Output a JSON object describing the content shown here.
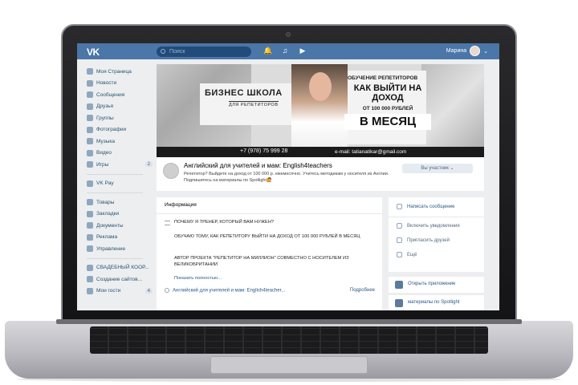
{
  "topbar": {
    "logo": "VK",
    "search_placeholder": "Поиск",
    "user_name": "Марина",
    "icons": [
      "bell-icon",
      "music-icon",
      "video-icon"
    ]
  },
  "nav": {
    "items": [
      {
        "label": "Моя Страница",
        "icon": "home-icon"
      },
      {
        "label": "Новости",
        "icon": "news-icon"
      },
      {
        "label": "Сообщения",
        "icon": "message-icon"
      },
      {
        "label": "Друзья",
        "icon": "friends-icon"
      },
      {
        "label": "Группы",
        "icon": "groups-icon"
      },
      {
        "label": "Фотографии",
        "icon": "photo-icon"
      },
      {
        "label": "Музыка",
        "icon": "music-icon"
      },
      {
        "label": "Видео",
        "icon": "video-icon"
      },
      {
        "label": "Игры",
        "icon": "games-icon",
        "badge": "2"
      }
    ],
    "pay": {
      "label": "VK Pay",
      "icon": "pay-icon"
    },
    "items2": [
      {
        "label": "Товары",
        "icon": "goods-icon"
      },
      {
        "label": "Закладки",
        "icon": "bookmark-icon"
      },
      {
        "label": "Документы",
        "icon": "document-icon"
      },
      {
        "label": "Реклама",
        "icon": "ads-icon"
      },
      {
        "label": "Управление",
        "icon": "manage-icon"
      }
    ],
    "items3": [
      {
        "label": "СВАДЕБНЫЙ КООР...",
        "icon": "group-icon"
      },
      {
        "label": "Создание сайтов...",
        "icon": "group-icon"
      },
      {
        "label": "Мои гости",
        "icon": "guests-icon",
        "badge": "4"
      }
    ]
  },
  "cover": {
    "left_title": "БИЗНЕС ШКОЛА",
    "left_sub": "ДЛЯ РЕПЕТИТОРОВ",
    "right_1": "ОБУЧЕНИЕ РЕПЕТИТОРОВ",
    "right_2": "КАК ВЫЙТИ НА ДОХОД",
    "right_3": "ОТ 100 000 РУБЛЕЙ",
    "right_4": "В МЕСЯЦ",
    "phone": "+7 (978) 75 999 28",
    "email": "e-mail: tatianatikar@gmail.com"
  },
  "group": {
    "name": "Английский для учителей и мам: English4teachers",
    "description": "Репетитор? Выйдите на доход от 100 000 р. ежемесячно. Учитесь методикам у носителя из Англии. Подпишитесь на материалы по Spotlight🙋",
    "member_button": "Вы участник ⌄"
  },
  "info": {
    "title": "Информация",
    "line1": "ПОЧЕМУ Я ТРЕНЕР, КОТОРЫЙ ВАМ НУЖЕН?",
    "line2": "ОБУЧАЮ ТОМУ, КАК РЕПЕТИТОРУ ВЫЙТИ НА ДОХОД ОТ 100 000 РУБЛЕЙ В МЕСЯЦ",
    "line3": "АВТОР ПРОЕКТА \"РЕПЕТИТОР НА МИЛЛИОН\" СОВМЕСТНО С НОСИТЕЛЕМ ИЗ ВЕЛИКОБРИТАНИИ",
    "more": "Показать полностью...",
    "link": "Английский для учителей и мам: English4teacher...",
    "details": "Подробнее"
  },
  "actions": {
    "write": "Написать сообщение",
    "notify": "Включить уведомления",
    "invite": "Пригласить друзей",
    "more": "Ещё"
  },
  "apps": {
    "open": "Открыть приложение",
    "spotlight": "материалы по Spotlight"
  }
}
